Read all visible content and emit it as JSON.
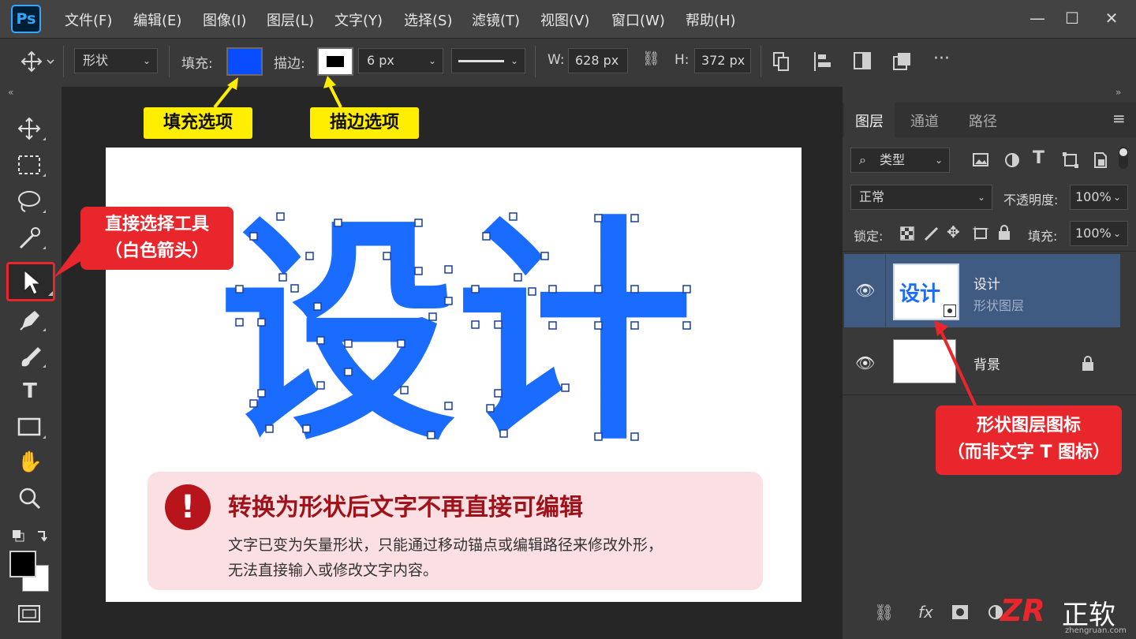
{
  "app": {
    "logo": "Ps"
  },
  "menu": [
    "文件(F)",
    "编辑(E)",
    "图像(I)",
    "图层(L)",
    "文字(Y)",
    "选择(S)",
    "滤镜(T)",
    "视图(V)",
    "窗口(W)",
    "帮助(H)"
  ],
  "window_controls": {
    "minimize": "—",
    "maximize": "☐",
    "close": "✕"
  },
  "options": {
    "mode": "形状",
    "fill_label": "填充:",
    "fill_color": "#0a4dff",
    "stroke_label": "描边:",
    "stroke_width": "6 px",
    "w_label": "W:",
    "w_value": "628 px",
    "h_label": "H:",
    "h_value": "372 px"
  },
  "annotations": {
    "fill_option": "填充选项",
    "stroke_option": "描边选项",
    "direct_select_line1": "直接选择工具",
    "direct_select_line2": "（白色箭头）",
    "shape_icon_line1": "形状图层图标",
    "shape_icon_line2": "（而非文字 T 图标）"
  },
  "canvas": {
    "text": "设计",
    "shape_color": "#1a6bff",
    "warning_title": "转换为形状后文字不再直接可编辑",
    "warning_body_line1": "文字已变为矢量形状，只能通过移动锚点或编辑路径来修改外形，",
    "warning_body_line2": "无法直接输入或修改文字内容。"
  },
  "panel": {
    "tabs": [
      "图层",
      "通道",
      "路径"
    ],
    "filter_kind": "类型",
    "blend_mode": "正常",
    "opacity_label": "不透明度:",
    "opacity_value": "100%",
    "lock_label": "锁定:",
    "fill_label": "填充:",
    "fill_value": "100%",
    "layers": [
      {
        "name": "设计",
        "sub": "形状图层",
        "thumb_text": "设计"
      },
      {
        "name": "背景",
        "sub": ""
      }
    ]
  },
  "watermark": {
    "brand": "正软",
    "url": "zhengruan.com"
  },
  "colors": {
    "accent_red": "#e8262b",
    "accent_yellow": "#ffee00",
    "selected_layer": "#3f5b82"
  }
}
